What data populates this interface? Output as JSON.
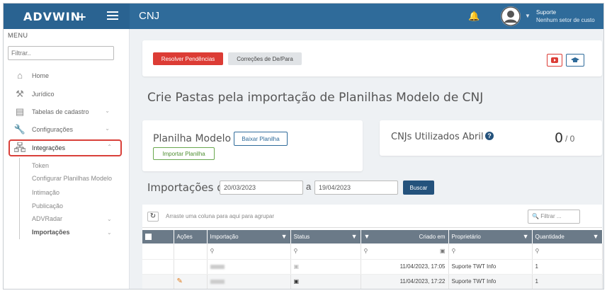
{
  "app": {
    "logo": "ADVWIN",
    "page_title": "CNJ"
  },
  "user": {
    "name": "Suporte",
    "sector": "Nenhum setor de custo"
  },
  "sidebar": {
    "menu_label": "MENU",
    "filter_placeholder": "Filtrar..",
    "items": [
      {
        "label": "Home",
        "icon": "home-icon"
      },
      {
        "label": "Jurídico",
        "icon": "gavel-icon"
      },
      {
        "label": "Tabelas de cadastro",
        "icon": "table-icon"
      },
      {
        "label": "Configurações",
        "icon": "wrench-icon"
      },
      {
        "label": "Integrações",
        "icon": "sitemap-icon"
      }
    ],
    "subitems": [
      "Token",
      "Configurar Planilhas Modelo",
      "Intimação",
      "Publicação",
      "ADVRadar",
      "Importações"
    ]
  },
  "top_card": {
    "resolve_label": "Resolver Pendências",
    "corrections_label": "Correções de De/Para"
  },
  "main": {
    "title": "Crie Pastas pela importação de Planilhas Modelo de CNJ"
  },
  "model_card": {
    "title": "Planilha Modelo",
    "download_label": "Baixar Planilha",
    "import_label": "Importar Planilha"
  },
  "cnj_card": {
    "title": "CNJs Utilizados Abril",
    "used": "0",
    "total": "/ 0"
  },
  "imports": {
    "label": "Importações de",
    "from": "20/03/2023",
    "sep": "a",
    "to": "19/04/2023",
    "search_label": "Buscar"
  },
  "grid": {
    "group_hint": "Arraste uma coluna para aqui para agrupar",
    "filter_placeholder": "Filtrar ...",
    "columns": [
      "Ações",
      "Importação",
      "Status",
      "Criado em",
      "Proprietário",
      "Quantidade"
    ],
    "rows": [
      {
        "created": "11/04/2023, 17:05",
        "owner": "Suporte TWT Info",
        "qty": "1"
      },
      {
        "created": "11/04/2023, 17:22",
        "owner": "Suporte TWT Info",
        "qty": "1"
      }
    ]
  },
  "colors": {
    "topbar": "#2f6b9a",
    "accent_red": "#dc3c35",
    "navy": "#24527c",
    "grid_header": "#6b7a88"
  }
}
